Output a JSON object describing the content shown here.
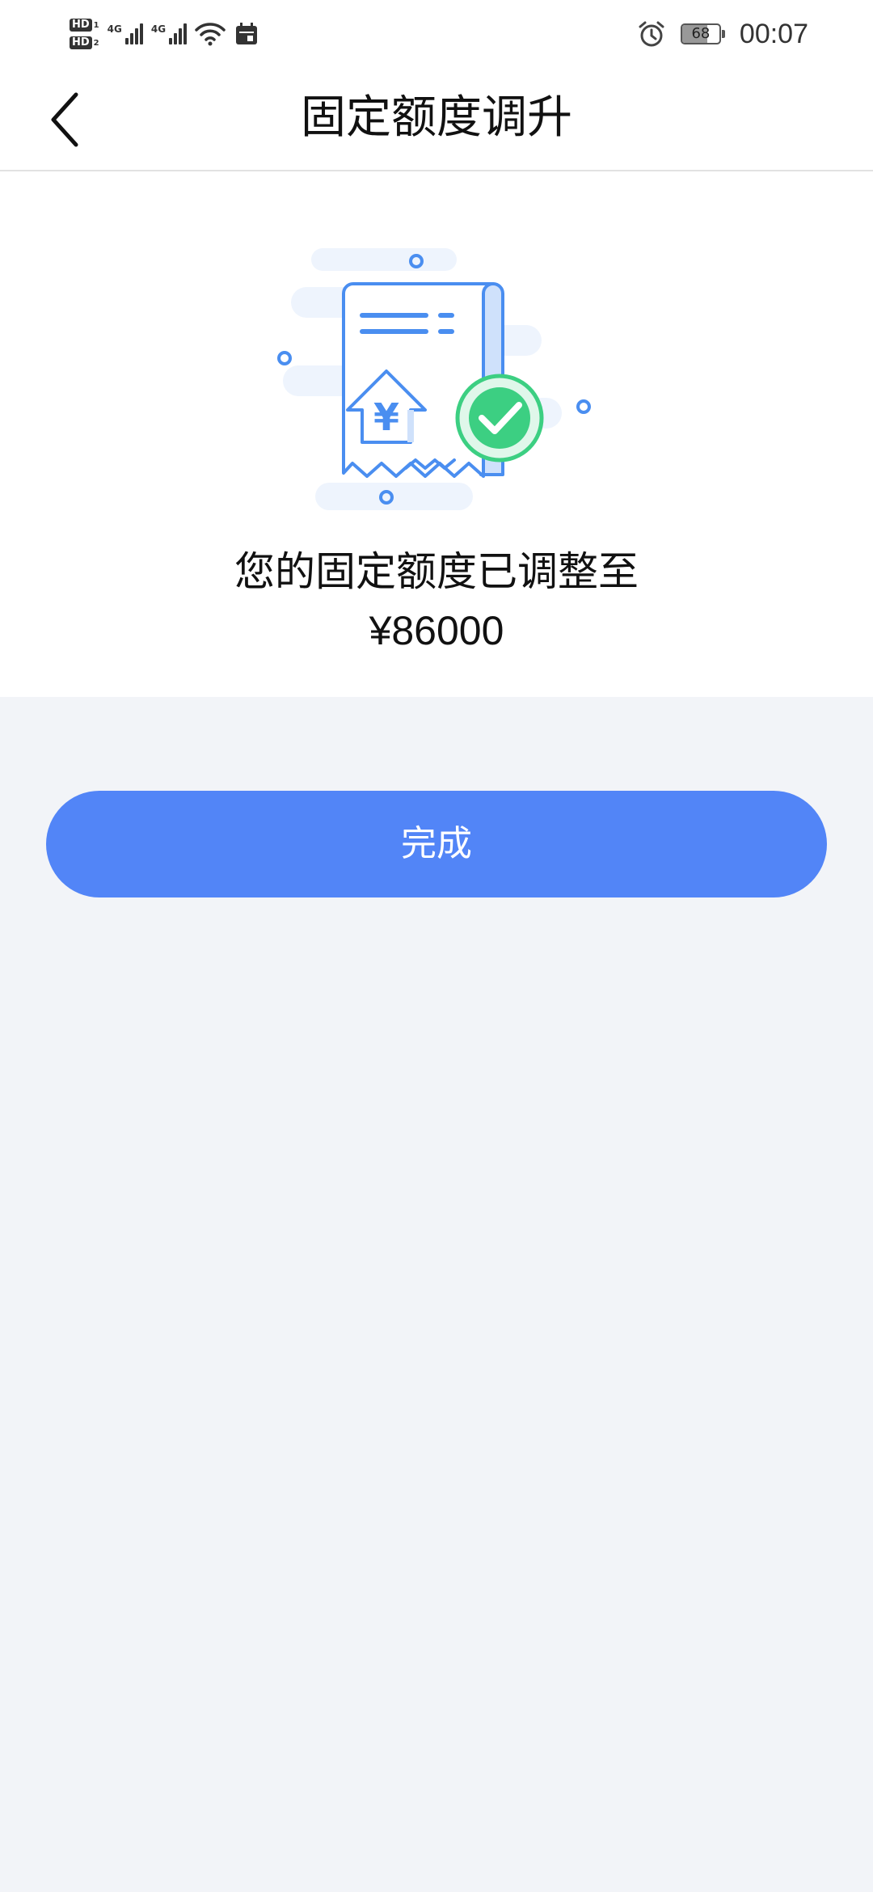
{
  "status_bar": {
    "hd1": "HD",
    "hd1_sub": "1",
    "hd2": "HD",
    "hd2_sub": "2",
    "network1": "4G",
    "network2": "4G",
    "battery_level": "68",
    "battery_fraction": 0.68,
    "time": "00:07"
  },
  "header": {
    "title": "固定额度调升"
  },
  "result": {
    "message": "您的固定额度已调整至",
    "amount": "¥86000",
    "illustration": {
      "currency_glyph": "¥"
    }
  },
  "actions": {
    "done_label": "完成"
  },
  "colors": {
    "primary": "#5285f7",
    "success": "#3ccf82",
    "page_bg": "#f2f4f8"
  },
  "icons": [
    "back-icon",
    "receipt-icon",
    "check-circle-icon",
    "alarm-icon",
    "wifi-icon",
    "calendar-icon",
    "battery-icon"
  ]
}
